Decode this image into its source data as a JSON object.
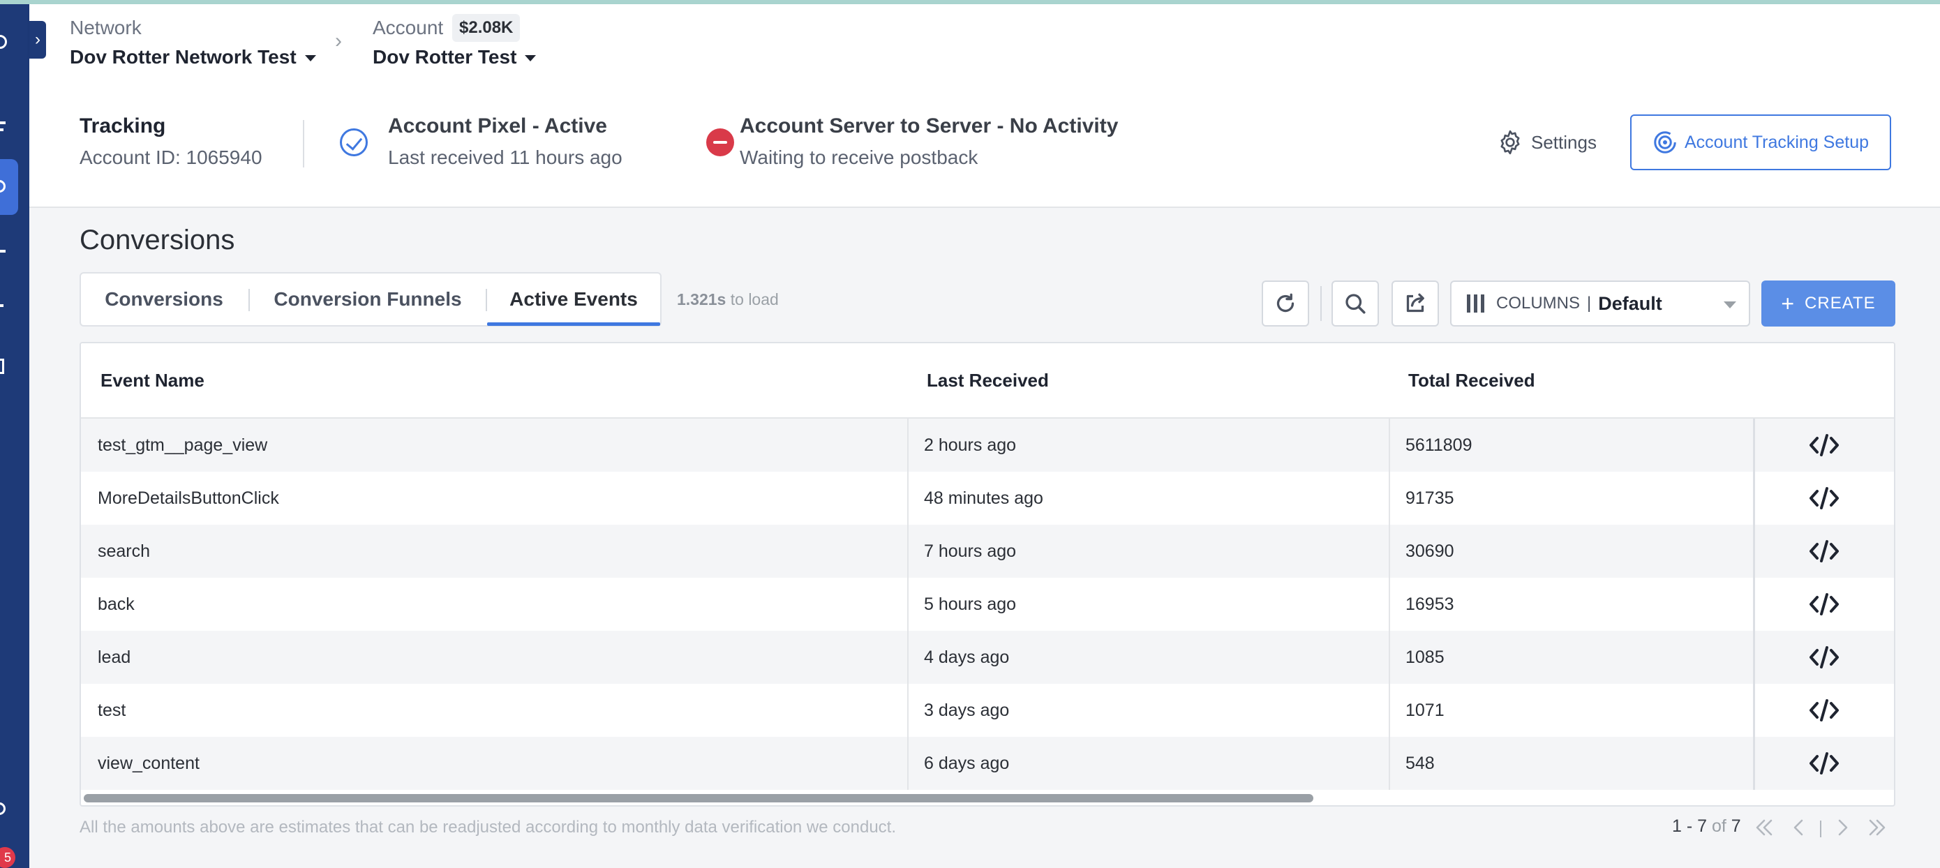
{
  "header": {
    "network_label": "Network",
    "network_value": "Dov Rotter Network Test",
    "account_label": "Account",
    "account_balance": "$2.08K",
    "account_value": "Dov Rotter Test"
  },
  "tracking": {
    "title": "Tracking",
    "account_id": "Account ID: 1065940",
    "pixel_title": "Account Pixel - Active",
    "pixel_sub": "Last received 11 hours ago",
    "s2s_title": "Account Server to Server - No Activity",
    "s2s_sub": "Waiting to receive postback",
    "settings_label": "Settings",
    "setup_label": "Account Tracking Setup"
  },
  "page": {
    "title": "Conversions",
    "tabs": [
      {
        "label": "Conversions",
        "active": false
      },
      {
        "label": "Conversion Funnels",
        "active": false
      },
      {
        "label": "Active Events",
        "active": true
      }
    ],
    "load_time": "1.321s",
    "load_suffix": "to load"
  },
  "toolbar": {
    "columns_label": "COLUMNS",
    "columns_sep": "|",
    "columns_value": "Default",
    "create_label": "CREATE"
  },
  "table": {
    "columns": [
      "Event Name",
      "Last Received",
      "Total Received"
    ],
    "rows": [
      {
        "event": "test_gtm__page_view",
        "last": "2 hours ago",
        "total": "5611809"
      },
      {
        "event": "MoreDetailsButtonClick",
        "last": "48 minutes ago",
        "total": "91735"
      },
      {
        "event": "search",
        "last": "7 hours ago",
        "total": "30690"
      },
      {
        "event": "back",
        "last": "5 hours ago",
        "total": "16953"
      },
      {
        "event": "lead",
        "last": "4 days ago",
        "total": "1085"
      },
      {
        "event": "test",
        "last": "3 days ago",
        "total": "1071"
      },
      {
        "event": "view_content",
        "last": "6 days ago",
        "total": "548"
      }
    ]
  },
  "footer": {
    "note": "All the amounts above are estimates that can be readjusted according to monthly data verification we conduct.",
    "pager_range": "1 - 7",
    "pager_of": "of",
    "pager_total": "7"
  },
  "sidebar": {
    "badge": "5"
  },
  "colors": {
    "sidebar": "#1e3a78",
    "accent": "#3f78e0",
    "create": "#5b8ee6",
    "error": "#d93a49"
  }
}
